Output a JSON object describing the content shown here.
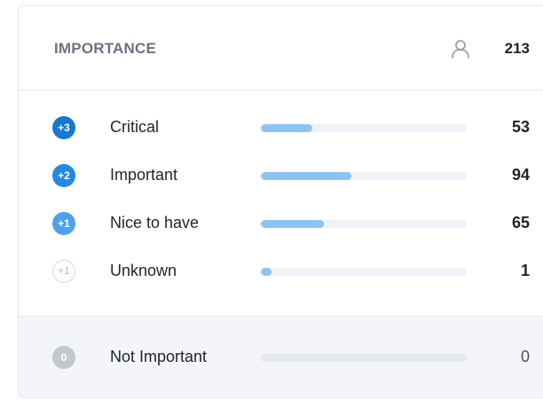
{
  "header": {
    "title": "IMPORTANCE",
    "user_icon": "user-icon",
    "total": "213"
  },
  "rows": [
    {
      "badge": "+3",
      "label": "Critical",
      "count": "53",
      "value": 53,
      "badge_color": "#1478d4",
      "style": "filled"
    },
    {
      "badge": "+2",
      "label": "Important",
      "count": "94",
      "value": 94,
      "badge_color": "#2389e6",
      "style": "filled"
    },
    {
      "badge": "+1",
      "label": "Nice to have",
      "count": "65",
      "value": 65,
      "badge_color": "#4ea0ef",
      "style": "filled"
    },
    {
      "badge": "+1",
      "label": "Unknown",
      "count": "1",
      "value": 1,
      "badge_color": "#ffffff",
      "style": "outline"
    }
  ],
  "footer": {
    "badge": "0",
    "label": "Not Important",
    "count": "0",
    "value": 0
  },
  "scale_max": 213,
  "colors": {
    "bar_fill": "#8cc4f6",
    "bar_track": "#eef1f5"
  }
}
